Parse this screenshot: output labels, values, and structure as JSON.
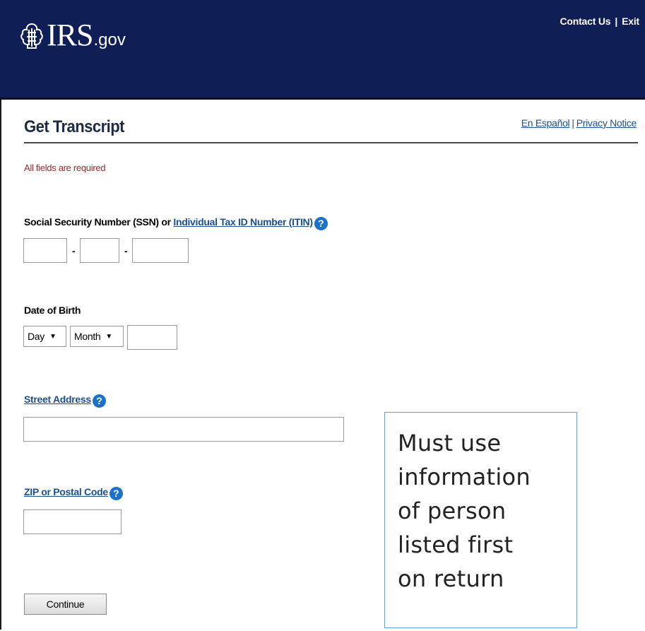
{
  "header": {
    "logo_irs": "IRS",
    "logo_gov": ".gov",
    "contact_label": "Contact Us",
    "separator": "|",
    "exit_label": "Exit"
  },
  "page": {
    "title": "Get Transcript",
    "spanish_link": "En Español",
    "privacy_link": "Privacy Notice",
    "link_separator": "|",
    "required_note": "All fields are required"
  },
  "form": {
    "ssn_label_prefix": "Social Security Number (SSN) or ",
    "ssn_label_link": "Individual Tax ID Number (ITIN)",
    "help_glyph": "?",
    "dash": "-",
    "dob_label": "Date of Birth",
    "dob_day": "Day",
    "dob_month": "Month",
    "select_arrow": "▼",
    "street_label": "Street Address",
    "zip_label": "ZIP or Postal Code",
    "continue_label": "Continue"
  },
  "callout": {
    "lines": [
      "Must use",
      "information",
      "of person",
      "listed first",
      "on return"
    ]
  },
  "colors": {
    "banner": "#0f1e55",
    "link": "#1f4e8c",
    "required_text": "#9a2a2a",
    "help_icon": "#1a73c9",
    "callout_border": "#6a9ccc"
  }
}
